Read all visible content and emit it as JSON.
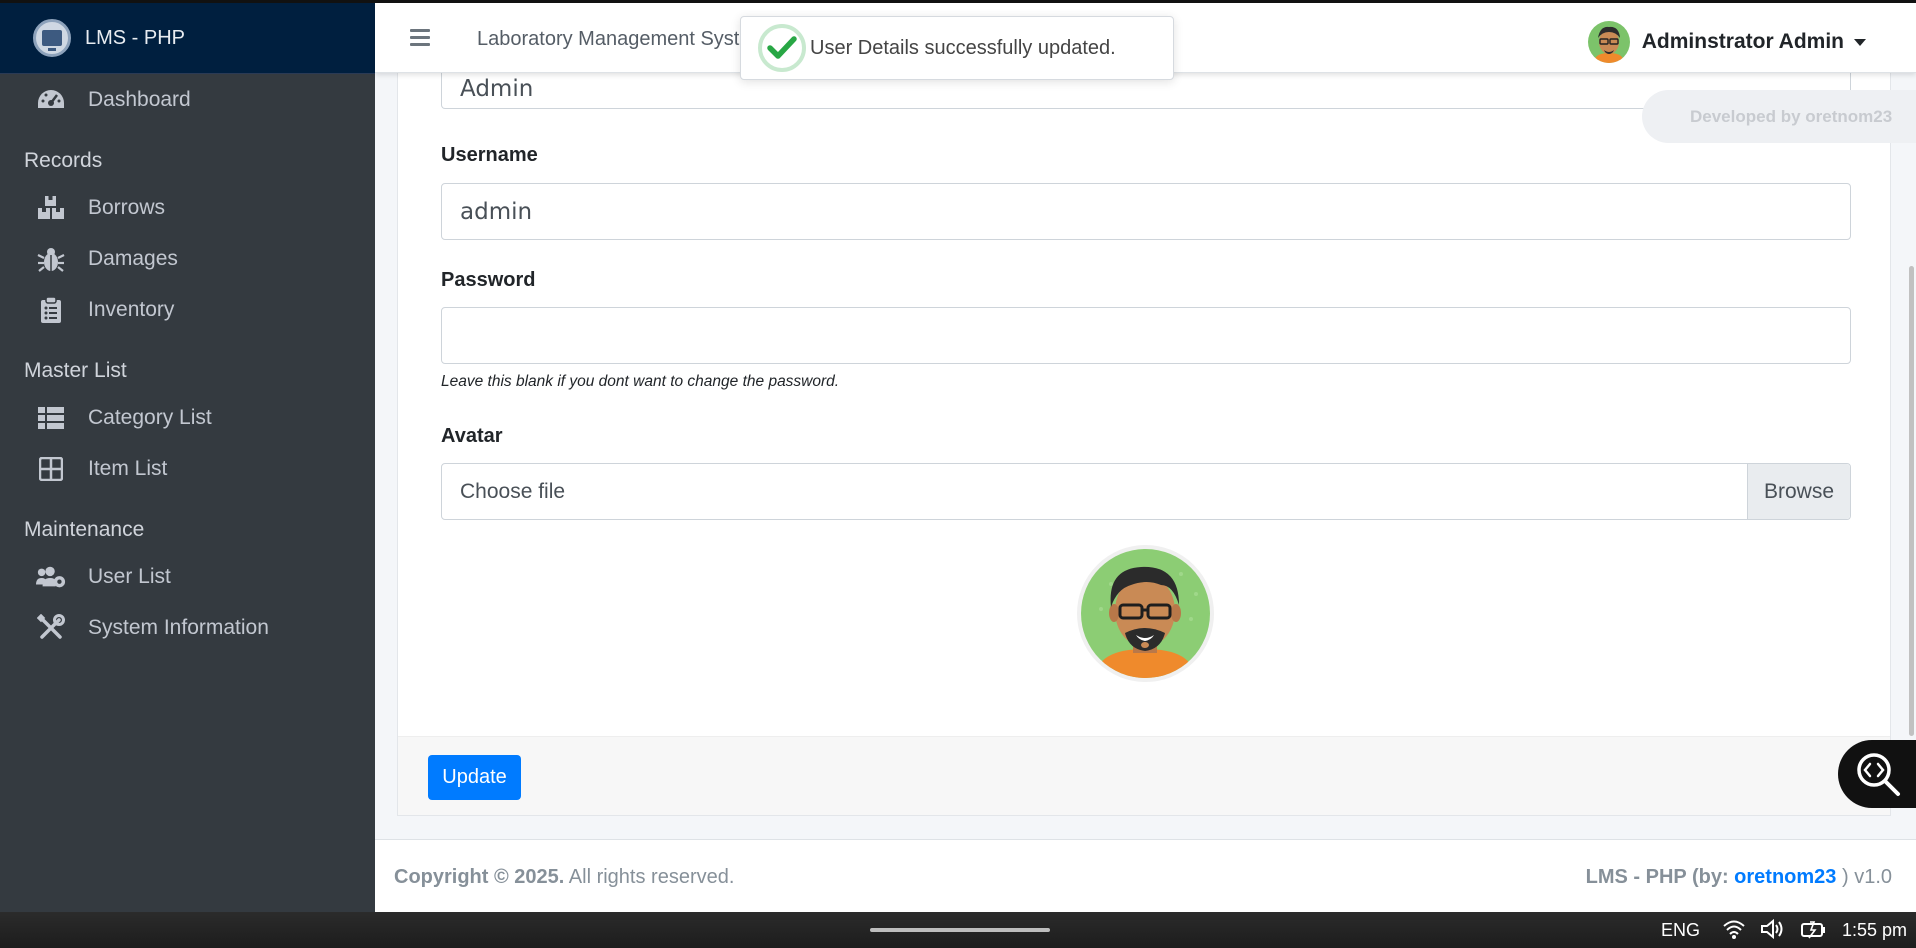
{
  "app": {
    "brand": "LMS - PHP",
    "system_title": "Laboratory Management System"
  },
  "sidebar": {
    "dashboard": "Dashboard",
    "sections": [
      {
        "header": "Records",
        "items": [
          "Borrows",
          "Damages",
          "Inventory"
        ]
      },
      {
        "header": "Master List",
        "items": [
          "Category List",
          "Item List"
        ]
      },
      {
        "header": "Maintenance",
        "items": [
          "User List",
          "System Information"
        ]
      }
    ]
  },
  "header": {
    "user_name": "Adminstrator Admin"
  },
  "toast": {
    "message": "User Details successfully updated."
  },
  "developed_by": "Developed by oretnom23",
  "form": {
    "lastname_value": "Admin",
    "username_label": "Username",
    "username_value": "admin",
    "password_label": "Password",
    "password_value": "",
    "password_hint": "Leave this blank if you dont want to change the password.",
    "avatar_label": "Avatar",
    "file_placeholder": "Choose file",
    "browse_label": "Browse",
    "update_label": "Update"
  },
  "footer": {
    "copyright_bold": "Copyright © 2025.",
    "copyright_rest": " All rights reserved.",
    "credit_prefix": "LMS - PHP (by: ",
    "credit_author": "oretnom23",
    "credit_suffix": " ) v1.0"
  },
  "taskbar": {
    "lang": "ENG",
    "time": "1:55 pm"
  },
  "colors": {
    "sidebar_bg": "#343a40",
    "brand_bg": "#001f3f",
    "primary": "#007bff",
    "success": "#28a745"
  }
}
